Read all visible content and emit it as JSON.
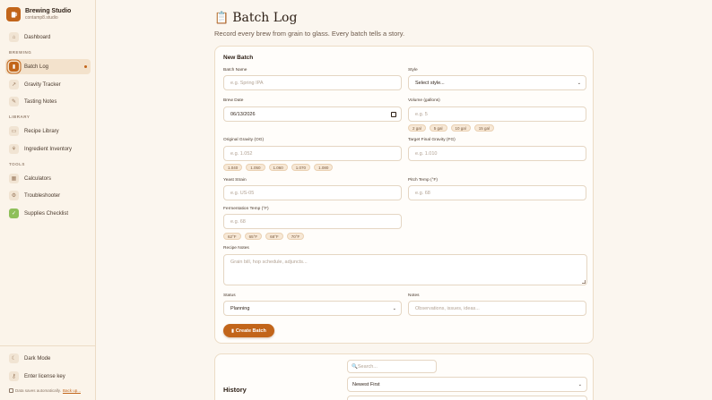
{
  "brand": {
    "name": "Brewing Studio",
    "subtitle": "contamp8.studio"
  },
  "sidebar": {
    "dashboard": {
      "label": "Dashboard",
      "icon": "home-icon"
    },
    "sections": {
      "brewing": "BREWING",
      "library": "LIBRARY",
      "tools": "TOOLS"
    },
    "brewing_items": [
      {
        "label": "Batch Log",
        "icon": "batch-log-icon",
        "active": true
      },
      {
        "label": "Gravity Tracker",
        "icon": "chart-icon"
      },
      {
        "label": "Tasting Notes",
        "icon": "notes-icon"
      }
    ],
    "library_items": [
      {
        "label": "Recipe Library",
        "icon": "book-icon"
      },
      {
        "label": "Ingredient Inventory",
        "icon": "ingredient-icon"
      }
    ],
    "tools_items": [
      {
        "label": "Calculators",
        "icon": "calculator-icon"
      },
      {
        "label": "Troubleshooter",
        "icon": "wrench-icon"
      },
      {
        "label": "Supplies Checklist",
        "icon": "checklist-icon"
      }
    ],
    "dark_mode": "Dark Mode",
    "license": "Enter license key",
    "footer_text": "Data saves automatically.",
    "footer_link": "Back up..."
  },
  "page": {
    "icon": "📋",
    "title": "Batch Log",
    "subtitle": "Record every brew from grain to glass. Every batch tells a story."
  },
  "form": {
    "title": "New Batch",
    "batch_name": {
      "label": "Batch Name",
      "placeholder": "e.g. Spring IPA"
    },
    "style": {
      "label": "Style",
      "value": "Select style..."
    },
    "brew_date": {
      "label": "Brew Date",
      "value": "06/13/2026"
    },
    "volume": {
      "label": "Volume (gallons)",
      "placeholder": "e.g. 5",
      "chips": [
        "2 gal",
        "5 gal",
        "10 gal",
        "15 gal"
      ]
    },
    "og": {
      "label": "Original Gravity (OG)",
      "placeholder": "e.g. 1.052",
      "chips": [
        "1.040",
        "1.050",
        "1.060",
        "1.070",
        "1.080"
      ]
    },
    "fg": {
      "label": "Target Final Gravity (FG)",
      "placeholder": "e.g. 1.010"
    },
    "yeast": {
      "label": "Yeast Strain",
      "placeholder": "e.g. US-05"
    },
    "pitch_temp": {
      "label": "Pitch Temp (°F)",
      "placeholder": "e.g. 68"
    },
    "ferm_temp": {
      "label": "Fermentation Temp (°F)",
      "placeholder": "e.g. 68",
      "chips": [
        "62°F",
        "65°F",
        "68°F",
        "70°F"
      ]
    },
    "recipe_notes": {
      "label": "Recipe Notes",
      "placeholder": "Grain bill, hop schedule, adjuncts..."
    },
    "status": {
      "label": "Status",
      "value": "Planning"
    },
    "notes": {
      "label": "Notes",
      "placeholder": "Observations, issues, ideas..."
    },
    "create_button": "Create Batch"
  },
  "history": {
    "title": "History",
    "search_placeholder": "🔍Search...",
    "sort_value": "Newest First"
  },
  "colors": {
    "accent": "#c2651a",
    "background": "#fbf6ef",
    "sidebar": "#fbf4ea"
  }
}
